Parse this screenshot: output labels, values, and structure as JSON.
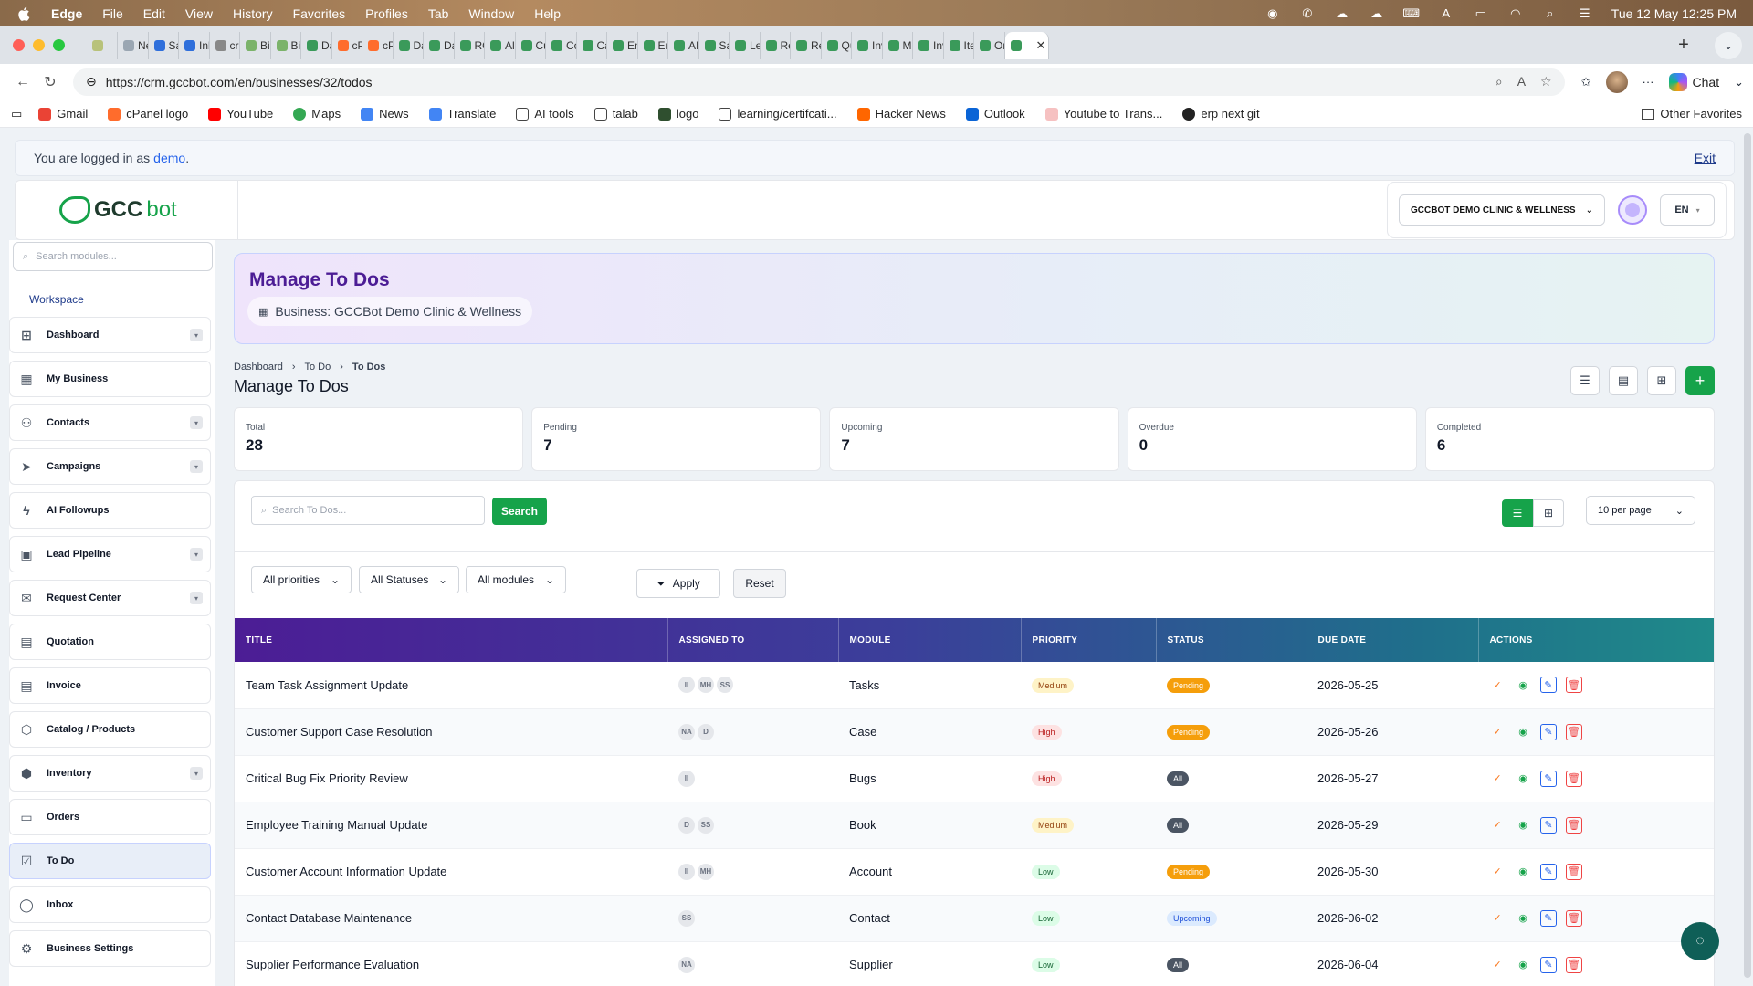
{
  "menubar": {
    "items": [
      "Edge",
      "File",
      "Edit",
      "View",
      "History",
      "Favorites",
      "Profiles",
      "Tab",
      "Window",
      "Help"
    ],
    "clock": "Tue 12 May  12:25 PM"
  },
  "tabs": [
    "New",
    "Sam",
    "Inbo",
    "crm",
    "BioT",
    "BioT",
    "Das",
    "cPa",
    "cPa",
    "Das",
    "Das",
    "ROI",
    "All E",
    "Cus",
    "Cor",
    "Can",
    "Ema",
    "Ema",
    "AI C",
    "Sale",
    "Lea",
    "Req",
    "Req",
    "Quo",
    "Invo",
    "Mar",
    "Inve",
    "Iten",
    "Ord"
  ],
  "address": {
    "url": "https://crm.gccbot.com/en/businesses/32/todos",
    "chat_label": "Chat"
  },
  "bookmarks": {
    "items": [
      "Gmail",
      "cPanel logo",
      "YouTube",
      "Maps",
      "News",
      "Translate",
      "AI tools",
      "talab",
      "logo",
      "learning/certifcati...",
      "Hacker News",
      "Outlook",
      "Youtube to Trans...",
      "erp next git"
    ],
    "other": "Other Favorites"
  },
  "login": {
    "prefix": "You are logged in as",
    "user": "demo",
    "suffix": ".",
    "exit": "Exit"
  },
  "header": {
    "logo_main": "GCC",
    "logo_bot": "bot",
    "business": "GCCBOT DEMO CLINIC & WELLNESS",
    "lang": "EN"
  },
  "sidebar": {
    "search_placeholder": "Search modules...",
    "section": "Workspace",
    "items": [
      {
        "label": "Dashboard",
        "icon": "grid-icon",
        "has_sub": true
      },
      {
        "label": "My Business",
        "icon": "building-icon",
        "has_sub": false
      },
      {
        "label": "Contacts",
        "icon": "users-icon",
        "has_sub": true
      },
      {
        "label": "Campaigns",
        "icon": "send-icon",
        "has_sub": true
      },
      {
        "label": "AI Followups",
        "icon": "bolt-icon",
        "has_sub": false
      },
      {
        "label": "Lead Pipeline",
        "icon": "briefcase-icon",
        "has_sub": true
      },
      {
        "label": "Request Center",
        "icon": "inbox-icon",
        "has_sub": true
      },
      {
        "label": "Quotation",
        "icon": "quote-doc-icon",
        "has_sub": false
      },
      {
        "label": "Invoice",
        "icon": "invoice-doc-icon",
        "has_sub": false
      },
      {
        "label": "Catalog / Products",
        "icon": "box-icon",
        "has_sub": false
      },
      {
        "label": "Inventory",
        "icon": "cube-icon",
        "has_sub": true
      },
      {
        "label": "Orders",
        "icon": "calendar-icon",
        "has_sub": false
      },
      {
        "label": "To Do",
        "icon": "checkbox-icon",
        "has_sub": false,
        "active": true
      },
      {
        "label": "Inbox",
        "icon": "whatsapp-icon",
        "has_sub": false
      },
      {
        "label": "Business Settings",
        "icon": "gear-icon",
        "has_sub": false
      }
    ]
  },
  "hero": {
    "title": "Manage To Dos",
    "business": "Business: GCCBot Demo Clinic & Wellness"
  },
  "breadcrumb": [
    "Dashboard",
    "To Do",
    "To Dos"
  ],
  "page_title": "Manage To Dos",
  "stats": [
    {
      "label": "Total",
      "value": "28"
    },
    {
      "label": "Pending",
      "value": "7"
    },
    {
      "label": "Upcoming",
      "value": "7"
    },
    {
      "label": "Overdue",
      "value": "0"
    },
    {
      "label": "Completed",
      "value": "6"
    }
  ],
  "toolbar": {
    "search_placeholder": "Search To Dos...",
    "search_button": "Search",
    "per_page": "10 per page"
  },
  "filters": {
    "priority": "All priorities",
    "status": "All Statuses",
    "module": "All modules",
    "apply": "Apply",
    "reset": "Reset"
  },
  "table": {
    "headers": [
      "TITLE",
      "ASSIGNED TO",
      "MODULE",
      "PRIORITY",
      "STATUS",
      "DUE DATE",
      "ACTIONS"
    ],
    "rows": [
      {
        "title": "Team Task Assignment Update",
        "assigned": [
          "II",
          "MH",
          "SS"
        ],
        "module": "Tasks",
        "priority": "Medium",
        "status": "Pending",
        "due": "2026-05-25"
      },
      {
        "title": "Customer Support Case Resolution",
        "assigned": [
          "NA",
          "D"
        ],
        "module": "Case",
        "priority": "High",
        "status": "Pending",
        "due": "2026-05-26"
      },
      {
        "title": "Critical Bug Fix Priority Review",
        "assigned": [
          "II"
        ],
        "module": "Bugs",
        "priority": "High",
        "status": "All",
        "due": "2026-05-27"
      },
      {
        "title": "Employee Training Manual Update",
        "assigned": [
          "D",
          "SS"
        ],
        "module": "Book",
        "priority": "Medium",
        "status": "All",
        "due": "2026-05-29"
      },
      {
        "title": "Customer Account Information Update",
        "assigned": [
          "II",
          "MH"
        ],
        "module": "Account",
        "priority": "Low",
        "status": "Pending",
        "due": "2026-05-30"
      },
      {
        "title": "Contact Database Maintenance",
        "assigned": [
          "SS"
        ],
        "module": "Contact",
        "priority": "Low",
        "status": "Upcoming",
        "due": "2026-06-02"
      },
      {
        "title": "Supplier Performance Evaluation",
        "assigned": [
          "NA"
        ],
        "module": "Supplier",
        "priority": "Low",
        "status": "All",
        "due": "2026-06-04"
      }
    ]
  }
}
